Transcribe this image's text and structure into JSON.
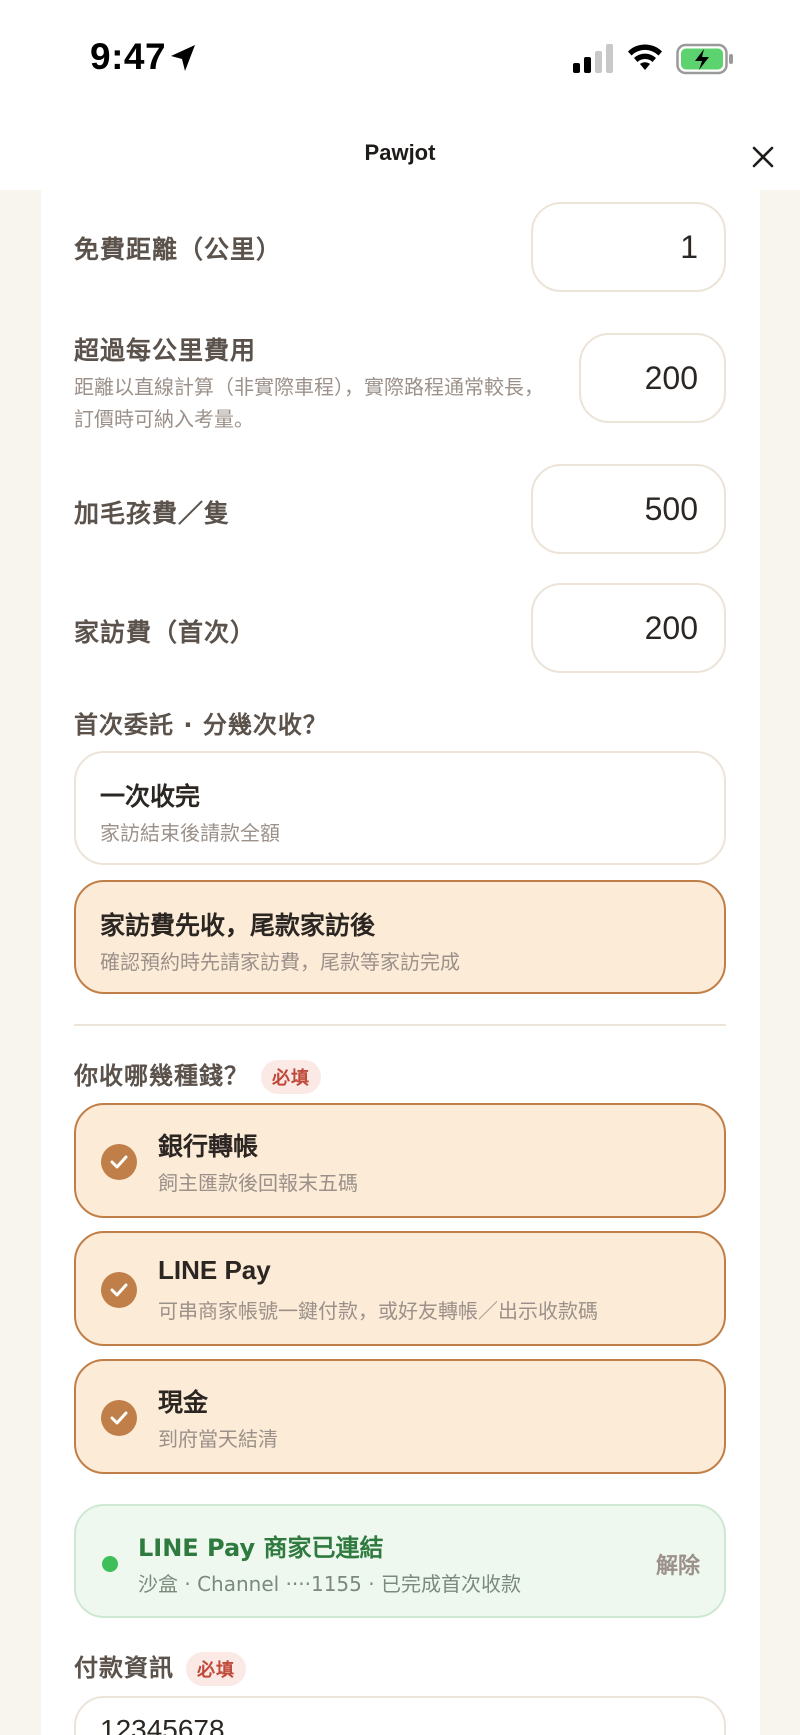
{
  "status_bar": {
    "time": "9:47",
    "icons": [
      "location-arrow-icon",
      "cellular-signal-icon",
      "wifi-icon",
      "battery-charging-icon"
    ]
  },
  "nav": {
    "title": "Pawjot",
    "close_icon": "close-icon"
  },
  "fees": {
    "free_distance": {
      "label": "免費距離（公里）",
      "value": "1"
    },
    "per_km": {
      "label": "超過每公里費用",
      "hint": "距離以直線計算（非實際車程），實際路程通常較長，訂價時可納入考量。",
      "value": "200"
    },
    "extra_pet": {
      "label": "加毛孩費／隻",
      "value": "500"
    },
    "home_visit": {
      "label": "家訪費（首次）",
      "value": "200"
    }
  },
  "installments": {
    "label": "首次委託 · 分幾次收？",
    "options": [
      {
        "title": "一次收完",
        "desc": "家訪結束後請款全額",
        "selected": false
      },
      {
        "title": "家訪費先收，尾款家訪後",
        "desc": "確認預約時先請家訪費，尾款等家訪完成",
        "selected": true
      }
    ]
  },
  "payment_methods": {
    "label": "你收哪幾種錢？",
    "required": "必填",
    "options": [
      {
        "title": "銀行轉帳",
        "desc": "飼主匯款後回報末五碼",
        "checked": true
      },
      {
        "title": "LINE Pay",
        "desc": "可串商家帳號一鍵付款，或好友轉帳／出示收款碼",
        "checked": true
      },
      {
        "title": "現金",
        "desc": "到府當天結清",
        "checked": true
      }
    ]
  },
  "linepay_merchant": {
    "title": "LINE Pay 商家已連結",
    "desc": "沙盒 · Channel ····1155 · 已完成首次收款",
    "action": "解除"
  },
  "payment_info": {
    "label": "付款資訊",
    "required": "必填",
    "value": "12345678"
  },
  "colors": {
    "accent": "#c07f48",
    "selected_bg": "#fcebd7",
    "page_bg": "#f8f4ee",
    "success": "#2f7a3f",
    "required": "#c04a3a"
  }
}
